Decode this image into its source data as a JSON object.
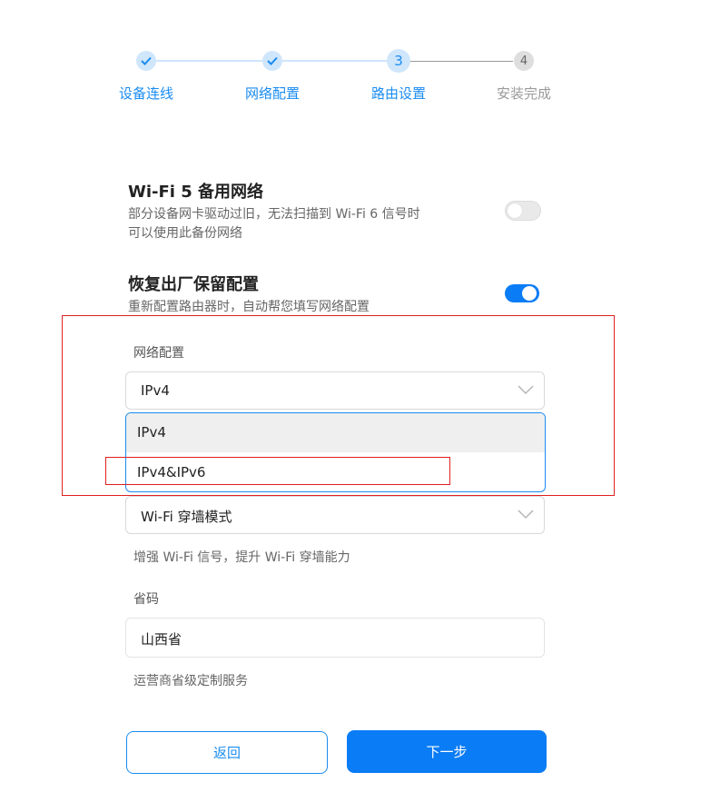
{
  "stepper": {
    "steps": [
      {
        "label": "设备连线",
        "state": "done"
      },
      {
        "label": "网络配置",
        "state": "done"
      },
      {
        "label": "路由设置",
        "state": "current",
        "number": "3"
      },
      {
        "label": "安装完成",
        "state": "pending",
        "number": "4"
      }
    ]
  },
  "wifi5_backup": {
    "title": "Wi-Fi 5 备用网络",
    "desc_line1": "部分设备网卡驱动过旧，无法扫描到 Wi-Fi 6 信号时",
    "desc_line2": "可以使用此备份网络",
    "enabled": false
  },
  "factory_reset_keep": {
    "title": "恢复出厂保留配置",
    "desc": "重新配置路由器时，自动帮您填写网络配置",
    "enabled": true
  },
  "network_config": {
    "label": "网络配置",
    "selected": "IPv4",
    "options": [
      "IPv4",
      "IPv4&IPv6"
    ]
  },
  "wall_mode": {
    "selected": "Wi-Fi 穿墙模式",
    "hint": "增强 Wi-Fi 信号，提升 Wi-Fi 穿墙能力"
  },
  "province": {
    "label": "省码",
    "value": "山西省",
    "hint": "运营商省级定制服务"
  },
  "buttons": {
    "back": "返回",
    "next": "下一步"
  },
  "colors": {
    "primary": "#0a7cf5",
    "annotation_red": "#e02020"
  }
}
